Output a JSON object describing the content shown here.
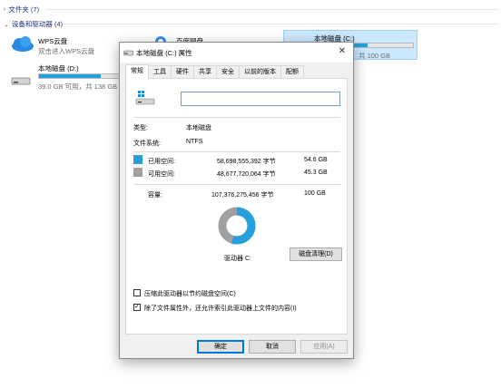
{
  "explorer": {
    "folders_header": "文件夹 (7)",
    "devices_header": "设备和驱动器 (4)",
    "drives": [
      {
        "name": "WPS云盘",
        "sub": "双击进入WPS云盘"
      },
      {
        "name": "百度网盘",
        "sub": ""
      },
      {
        "name": "本地磁盘 (C:)",
        "sub": "共 100 GB",
        "usage": 0.54
      },
      {
        "name": "本地磁盘 (D:)",
        "sub": "39.0 GB 可用，共 138 GB",
        "usage": 0.72
      }
    ]
  },
  "dialog": {
    "title": "本地磁盘 (C:) 属性",
    "close_label": "✕",
    "tabs": [
      "常规",
      "工具",
      "硬件",
      "共享",
      "安全",
      "以前的版本",
      "配额"
    ],
    "name_value": "",
    "type_label": "类型:",
    "type_value": "本地磁盘",
    "fs_label": "文件系统:",
    "fs_value": "NTFS",
    "used_label": "已用空间:",
    "used_bytes": "58,698,555,392 字节",
    "used_size": "54.6 GB",
    "free_label": "可用空间:",
    "free_bytes": "48,677,720,064 字节",
    "free_size": "45.3 GB",
    "capacity_label": "容量:",
    "capacity_bytes": "107,376,275,456 字节",
    "capacity_size": "100 GB",
    "drive_label": "驱动器 C:",
    "cleanup_button": "磁盘清理(D)",
    "compress_label": "压缩此驱动器以节约磁盘空间(C)",
    "compress_checked": false,
    "index_label": "除了文件属性外，还允许索引此驱动器上文件的内容(I)",
    "index_checked": true,
    "ok_button": "确定",
    "cancel_button": "取消",
    "apply_button": "应用(A)",
    "used_fraction": 0.547,
    "colors": {
      "used": "#26a0da",
      "free": "#a0a0a0"
    }
  }
}
